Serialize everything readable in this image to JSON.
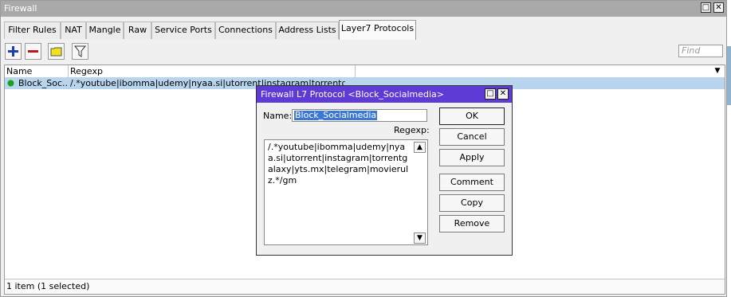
{
  "window": {
    "title": "Firewall",
    "restore_icon": "□",
    "close_icon": "✕"
  },
  "tabs": [
    {
      "label": "Filter Rules"
    },
    {
      "label": "NAT"
    },
    {
      "label": "Mangle"
    },
    {
      "label": "Raw"
    },
    {
      "label": "Service Ports"
    },
    {
      "label": "Connections"
    },
    {
      "label": "Address Lists"
    },
    {
      "label": "Layer7 Protocols",
      "active": true
    }
  ],
  "toolbar": {
    "add_icon": "plus-icon",
    "remove_icon": "minus-icon",
    "comment_icon": "comment-icon",
    "filter_icon": "filter-icon",
    "find_placeholder": "Find"
  },
  "table": {
    "columns": [
      "Name",
      "Regexp"
    ],
    "rows": [
      {
        "status_color": "#1aa11a",
        "name": "Block_Soc...",
        "regexp": "/.*youtube|ibomma|udemy|nyaa.si|utorrent|instagram|torrentgalaxy|y..."
      }
    ]
  },
  "status_text": "1 item (1 selected)",
  "dialog": {
    "title": "Firewall L7 Protocol <Block_Socialmedia>",
    "name_label": "Name:",
    "name_value": "Block_Socialmedia",
    "regexp_label": "Regexp:",
    "regexp_value": "/.*youtube|ibomma|udemy|nyaa.si|utorrent|instagram|torrentgalaxy|yts.mx|telegram|movierulz.*/gm",
    "buttons": {
      "ok": "OK",
      "cancel": "Cancel",
      "apply": "Apply",
      "comment": "Comment",
      "copy": "Copy",
      "remove": "Remove"
    }
  },
  "colors": {
    "titlebar": "#a9a9a9",
    "dialog_titlebar": "#5f3bd6",
    "selection": "#b9d5ee",
    "add_icon": "#1f3fb0",
    "remove_icon": "#c0151b",
    "comment_icon": "#f2e21c"
  }
}
